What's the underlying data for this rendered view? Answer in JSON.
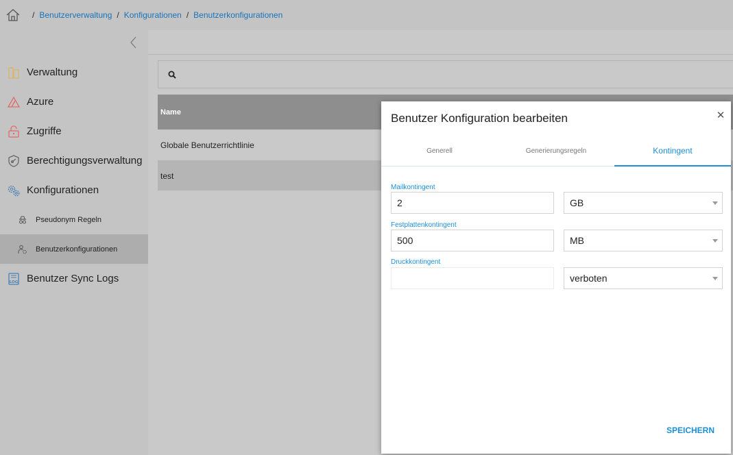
{
  "breadcrumb": {
    "icon": "home-icon",
    "items": [
      "Benutzerverwaltung",
      "Konfigurationen",
      "Benutzerkonfigurationen"
    ]
  },
  "sidebar": {
    "items": [
      {
        "label": "Verwaltung",
        "icon": "folder-icon"
      },
      {
        "label": "Azure",
        "icon": "azure-icon"
      },
      {
        "label": "Zugriffe",
        "icon": "lock-icon"
      },
      {
        "label": "Berechtigungsverwaltung",
        "icon": "shield-icon"
      },
      {
        "label": "Konfigurationen",
        "icon": "gears-icon"
      }
    ],
    "subitems": [
      {
        "label": "Pseudonym Regeln",
        "icon": "incognito-icon"
      },
      {
        "label": "Benutzerkonfigurationen",
        "icon": "user-config-icon",
        "active": true
      }
    ],
    "bottom_item": {
      "label": "Benutzer Sync Logs",
      "icon": "log-icon"
    }
  },
  "table": {
    "header": "Name",
    "rows": [
      "Globale Benutzerrichtlinie",
      "test"
    ]
  },
  "dialog": {
    "title": "Benutzer Konfiguration bearbeiten",
    "tabs": [
      "Generell",
      "Generierungsregeln",
      "Kontingent"
    ],
    "active_tab": "Kontingent",
    "fields": [
      {
        "label": "Mailkontingent",
        "value": "2",
        "unit": "GB"
      },
      {
        "label": "Festplattenkontingent",
        "value": "500",
        "unit": "MB"
      },
      {
        "label": "Druckkontingent",
        "value": "",
        "unit": "verboten"
      }
    ],
    "save_label": "SPEICHERN"
  },
  "colors": {
    "accent": "#1a8fd6",
    "link": "#1a73b8",
    "table_header": "#8e8e8e"
  }
}
